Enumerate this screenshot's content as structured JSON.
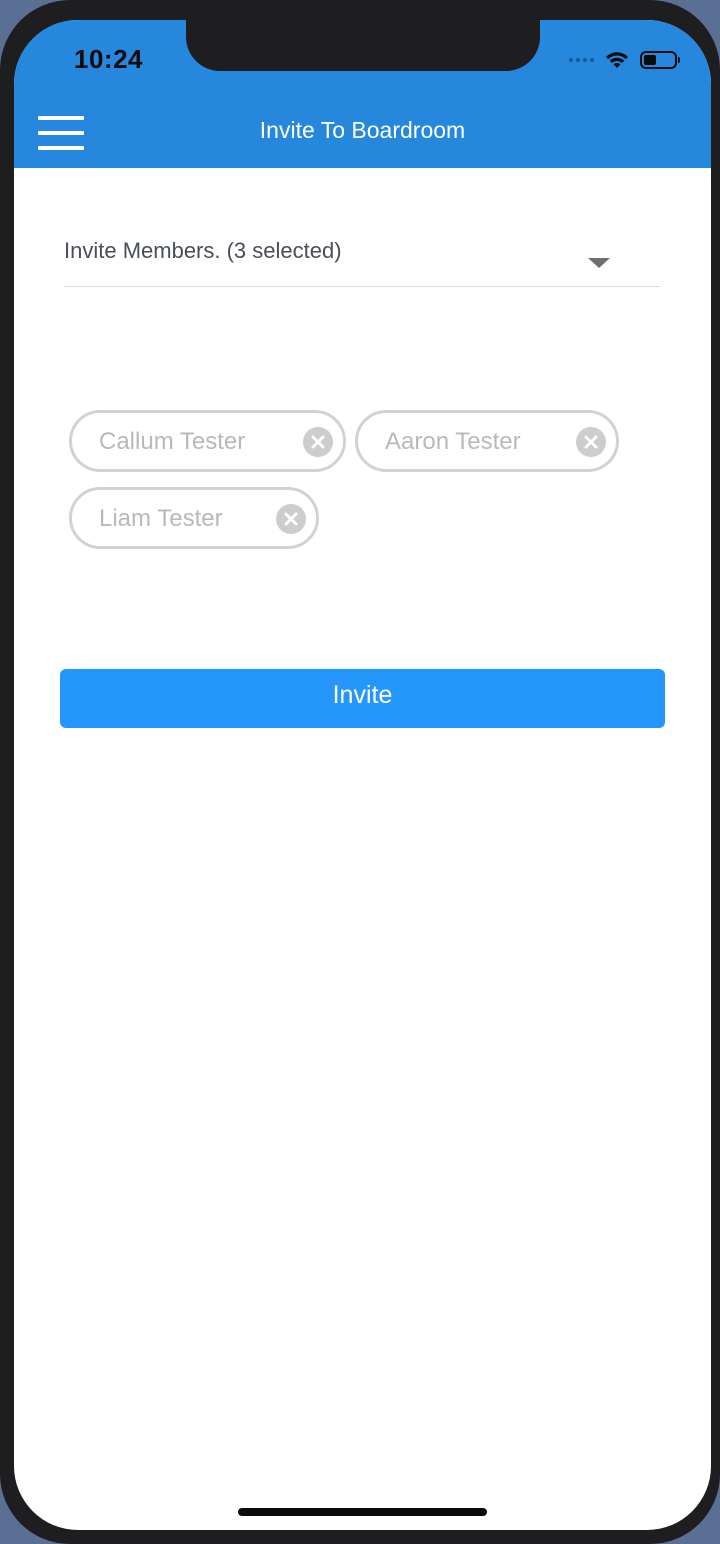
{
  "status_bar": {
    "time": "10:24",
    "icons": [
      "signal-icon",
      "wifi-icon",
      "battery-icon"
    ]
  },
  "header": {
    "title": "Invite To Boardroom",
    "menu_icon": "hamburger-menu-icon",
    "background_color": "#2688dd"
  },
  "member_select": {
    "label": "Invite Members. (3 selected)",
    "selected_count": 3
  },
  "selected_members": [
    {
      "name": "Callum Tester"
    },
    {
      "name": "Aaron Tester"
    },
    {
      "name": "Liam Tester"
    }
  ],
  "actions": {
    "invite_label": "Invite",
    "invite_color": "#2596fb"
  }
}
